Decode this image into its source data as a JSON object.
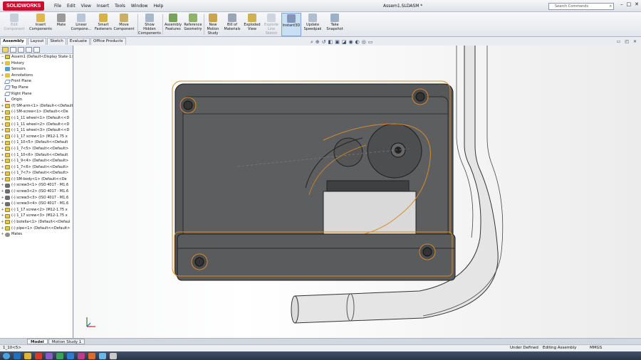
{
  "app": {
    "logo_text": "SOLIDWORKS",
    "window_title": "Assem1.SLDASM *",
    "menus": [
      "File",
      "Edit",
      "View",
      "Insert",
      "Tools",
      "Window",
      "Help"
    ],
    "search_placeholder": "Search Commands",
    "window_buttons": [
      "–",
      "□",
      "✕"
    ]
  },
  "ribbon": {
    "edit_component": "Edit\nComponent",
    "insert_components": "Insert\nComponents",
    "mate": "Mate",
    "linear_component": "Linear\nCompone...",
    "smart_fasteners": "Smart\nFasteners",
    "move_component": "Move\nComponent",
    "show_hidden": "Show\nHidden\nComponents",
    "assembly_features": "Assembly\nFeatures",
    "reference_geometry": "Reference\nGeometry",
    "new_motion_study": "New\nMotion\nStudy",
    "bill_of_materials": "Bill of\nMaterials",
    "exploded_view": "Exploded\nView",
    "explode_line_sketch": "Explode\nLine\nSketch",
    "instant3d": "Instant3D",
    "update_speedpak": "Update\nSpeedpak",
    "take_snapshot": "Take\nSnapshot"
  },
  "command_tabs": [
    "Assembly",
    "Layout",
    "Sketch",
    "Evaluate",
    "Office Products"
  ],
  "feature_tree": {
    "items": [
      {
        "label": "Assem1  (Default<Display State-1>)",
        "icon": "asm",
        "exp": "−"
      },
      {
        "label": "History",
        "icon": "folder",
        "exp": "+"
      },
      {
        "label": "Sensors",
        "icon": "sensor",
        "exp": ""
      },
      {
        "label": "Annotations",
        "icon": "folder",
        "exp": "+"
      },
      {
        "label": "Front Plane",
        "icon": "plane",
        "exp": ""
      },
      {
        "label": "Top Plane",
        "icon": "plane",
        "exp": ""
      },
      {
        "label": "Right Plane",
        "icon": "plane",
        "exp": ""
      },
      {
        "label": "Origin",
        "icon": "origin",
        "exp": ""
      },
      {
        "label": "(f) SM-arm<1> (Default<<Default>",
        "icon": "part",
        "exp": "+"
      },
      {
        "label": "(-) SM-screw<1> (Default<<De",
        "icon": "part",
        "exp": "+"
      },
      {
        "label": "(-) 1_11 wheel<1> (Default<<D",
        "icon": "part",
        "exp": "+"
      },
      {
        "label": "(-) 1_11 wheel<2> (Default<<D",
        "icon": "part",
        "exp": "+"
      },
      {
        "label": "(-) 1_11 wheel<3> (Default<<D",
        "icon": "part",
        "exp": "+"
      },
      {
        "label": "(-) 1_17 screw<1> (M12-1.75 x",
        "icon": "part",
        "exp": "+"
      },
      {
        "label": "(-) 1_10<5> (Default<<Default",
        "icon": "part",
        "exp": "+"
      },
      {
        "label": "(-) 1_7<5> (Default<<Default>",
        "icon": "part",
        "exp": "+"
      },
      {
        "label": "(-) 1_10<6> (Default<<Default",
        "icon": "part",
        "exp": "+"
      },
      {
        "label": "(-) 1_9<4> (Default<<Default>",
        "icon": "part",
        "exp": "+"
      },
      {
        "label": "(-) 1_7<6> (Default<<Default>",
        "icon": "part",
        "exp": "+"
      },
      {
        "label": "(-) 1_7<7> (Default<<Default>",
        "icon": "part",
        "exp": "+"
      },
      {
        "label": "(-) SM-body<1> (Default<<De",
        "icon": "part",
        "exp": "+"
      },
      {
        "label": "(-) screw3<1> (ISO 4017 - M1.6",
        "icon": "screw",
        "exp": "+"
      },
      {
        "label": "(-) screw3<2> (ISO 4017 - M1.6",
        "icon": "screw",
        "exp": "+"
      },
      {
        "label": "(-) screw3<3> (ISO 4017 - M1.6",
        "icon": "screw",
        "exp": "+"
      },
      {
        "label": "(-) screw3<4> (ISO 4017 - M1.6",
        "icon": "screw",
        "exp": "+"
      },
      {
        "label": "(-) 1_17 screw<2> (M12-1.75 x",
        "icon": "part",
        "exp": "+"
      },
      {
        "label": "(-) 1_17 screw<3> (M12-1.75 x",
        "icon": "part",
        "exp": "+"
      },
      {
        "label": "(-) botella<1> (Default<<Defaul",
        "icon": "part",
        "exp": "+"
      },
      {
        "label": "(-) pipe<1> (Default<<Default>",
        "icon": "part",
        "exp": "+"
      },
      {
        "label": "Mates",
        "icon": "mate",
        "exp": "+"
      }
    ]
  },
  "bottom_tabs": [
    "Model",
    "Motion Study 1"
  ],
  "status": {
    "left": "1_10<5>",
    "state": "Under Defined",
    "mode": "Editing Assembly",
    "units": "MMGS"
  },
  "colors": {
    "body": "#5a5b5d",
    "edge": "#1c1c1c",
    "highlight": "#d98a2b",
    "selection": "#c9dff5"
  }
}
